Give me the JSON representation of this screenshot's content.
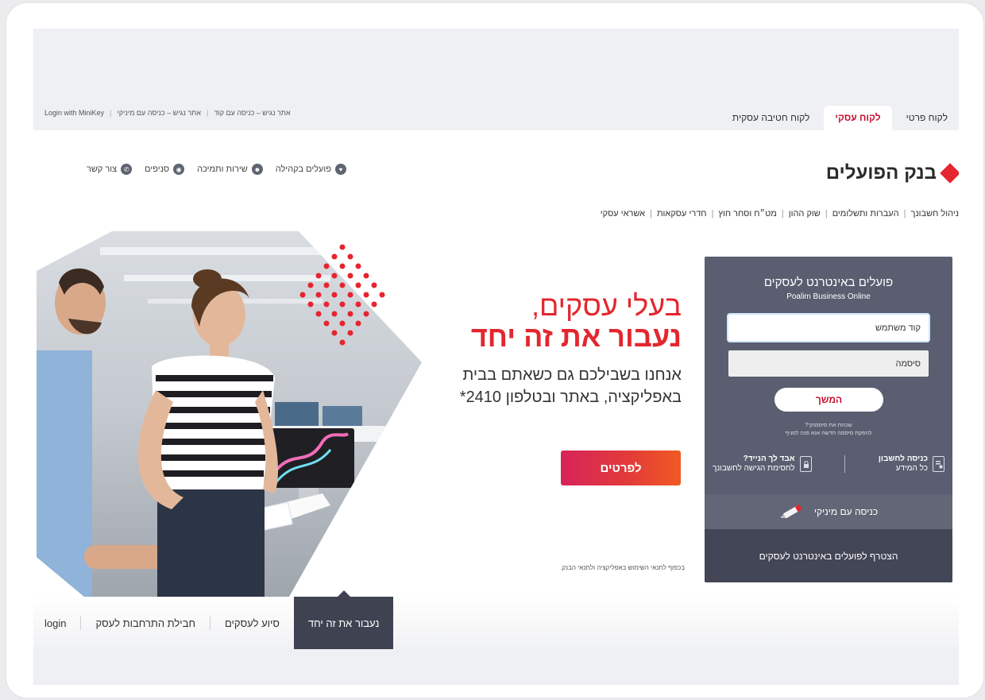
{
  "tabs": [
    {
      "label": "לקוח פרטי",
      "active": false
    },
    {
      "label": "לקוח עסקי",
      "active": true
    },
    {
      "label": "לקוח חטיבה עסקית",
      "active": false
    }
  ],
  "toplinks": {
    "minikey": "Login with MiniKey",
    "legacy_minikey": "אתר נגיש – כניסה עם מיניקי",
    "legacy_code": "אתר נגיש – כניסה עם קוד"
  },
  "logo": {
    "text": "בנק הפועלים"
  },
  "utility_nav": [
    {
      "label": "צור קשר",
      "icon": "phone-icon"
    },
    {
      "label": "סניפים",
      "icon": "location-icon"
    },
    {
      "label": "שירות ותמיכה",
      "icon": "support-icon"
    },
    {
      "label": "פועלים בקהילה",
      "icon": "heart-icon"
    }
  ],
  "main_nav": [
    "ניהול חשבונך",
    "העברות ותשלומים",
    "שוק ההון",
    "מט״ח וסחר חוץ",
    "חדרי עסקאות",
    "אשראי עסקי"
  ],
  "hero": {
    "title_line1": "בעלי עסקים,",
    "title_line2": "נעבור את זה יחד",
    "subtitle": "אנחנו בשבילכם גם כשאתם בבית באפליקציה, באתר ובטלפון 2410*",
    "cta_label": "לפרטים",
    "disclaimer": "בכפוף לתנאי השימוש באפליקציה ולתנאי הבנק."
  },
  "login": {
    "title": "פועלים באינטרנט לעסקים",
    "subtitle": "Poalim Business Online",
    "username_placeholder": "קוד משתמש",
    "password_placeholder": "סיסמה",
    "continue_label": "המשך",
    "forgot_line1": "שכחת את סיסמתך?",
    "forgot_line2": "להפקת סיסמה חדשה אנא פנה לסניף",
    "enter_account_title": "כניסה לחשבון",
    "enter_account_sub": "כל המידע",
    "lost_device_title": "אבד לך הנייד?",
    "lost_device_sub": "לחסימת הגישה לחשבונך",
    "minikey_label": "כניסה עם מיניקי",
    "join_label": "הצטרף לפועלים באינטרנט לעסקים"
  },
  "bottom_tabs": [
    {
      "label": "נעבור את זה יחד",
      "active": true
    },
    {
      "label": "סיוע לעסקים",
      "active": false
    },
    {
      "label": "חבילת התרחבות לעסק",
      "active": false
    },
    {
      "label": "login",
      "active": false
    }
  ],
  "colors": {
    "brand_red": "#e5252f",
    "card_bg": "#5a5e70",
    "dark_tab": "#3f4251"
  }
}
